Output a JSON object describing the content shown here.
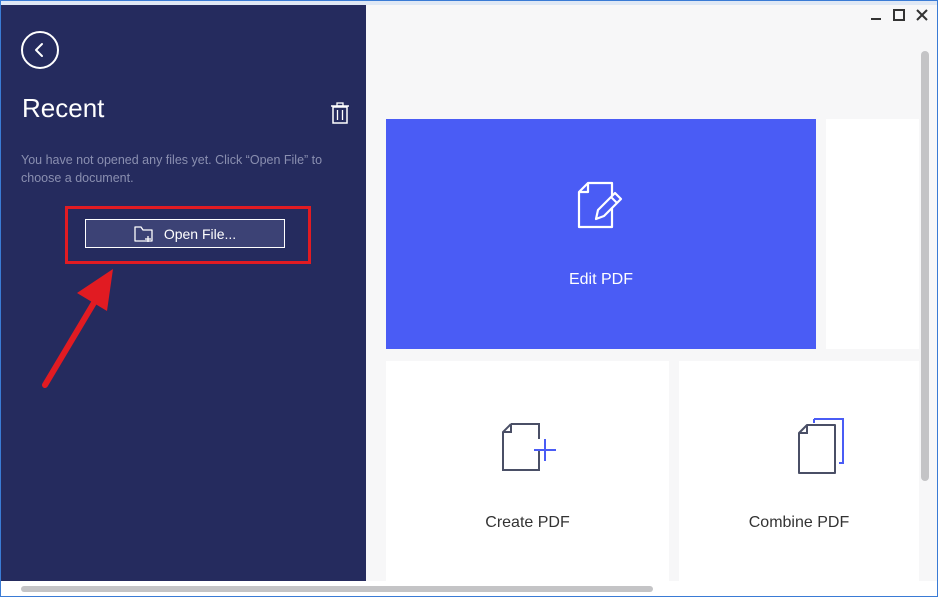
{
  "sidebar": {
    "title": "Recent",
    "empty_message": "You have not opened any files yet. Click “Open File” to choose a document.",
    "open_file_label": "Open File..."
  },
  "tiles": {
    "edit": "Edit PDF",
    "create": "Create PDF",
    "combine": "Combine PDF"
  },
  "colors": {
    "sidebar_bg": "#252b5e",
    "accent": "#4a5cf5",
    "highlight": "#e11b22",
    "annotation_arrow": "#e11b22"
  },
  "icons": {
    "back": "chevron-left-circle-icon",
    "trash": "trash-icon",
    "open_file": "folder-plus-icon",
    "edit": "document-pencil-icon",
    "create": "document-plus-icon",
    "combine": "documents-stack-icon"
  }
}
